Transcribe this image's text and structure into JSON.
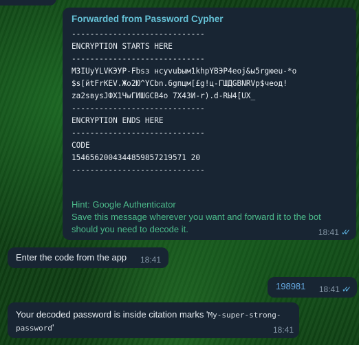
{
  "forwarded_message": {
    "header": "Forwarded from Password Cypher",
    "lines": [
      "-----------------------------",
      "ENCRYPTION STARTS HERE",
      "-----------------------------",
      "МЗIUyYLVKЭУP-Fbsз нсyvubым1khpYBЭP4eoj&ы5rgюeu-*o",
      "$s[йtFrKEV.Жо2Ю^YCbn.6gпцм[£g!ц-ГШДGBNRVр$чеод!",
      "za2sвysJФХ1ЧwГИШGCB4о 7Х43И-r).d-RЫ4[UX_",
      "-----------------------------",
      "ENCRYPTION ENDS HERE",
      "-----------------------------",
      "CODE",
      "1546562004344859857219571 20",
      "-----------------------------"
    ],
    "hint_title": "Hint: Google Authenticator",
    "hint_body": "Save this message wherever you want and forward it to the bot should you need to decode it.",
    "time": "18:41",
    "read_status": "read-double-check"
  },
  "messages": {
    "enter_code": {
      "text": "Enter the code from the app",
      "time": "18:41"
    },
    "code_sent": {
      "text": "198981",
      "time": "18:41",
      "read_status": "read-double-check"
    },
    "decoded": {
      "text_before": "Your decoded password is inside citation marks '",
      "password_part1": "My-super-strong-",
      "password_part2": "password",
      "text_after": "'",
      "time": "18:41"
    }
  },
  "colors": {
    "bubble": "#182533",
    "forward_header": "#65c1d6",
    "hint": "#4cbb8b",
    "check": "#5fb6e6",
    "code_text": "#65a8e0"
  }
}
